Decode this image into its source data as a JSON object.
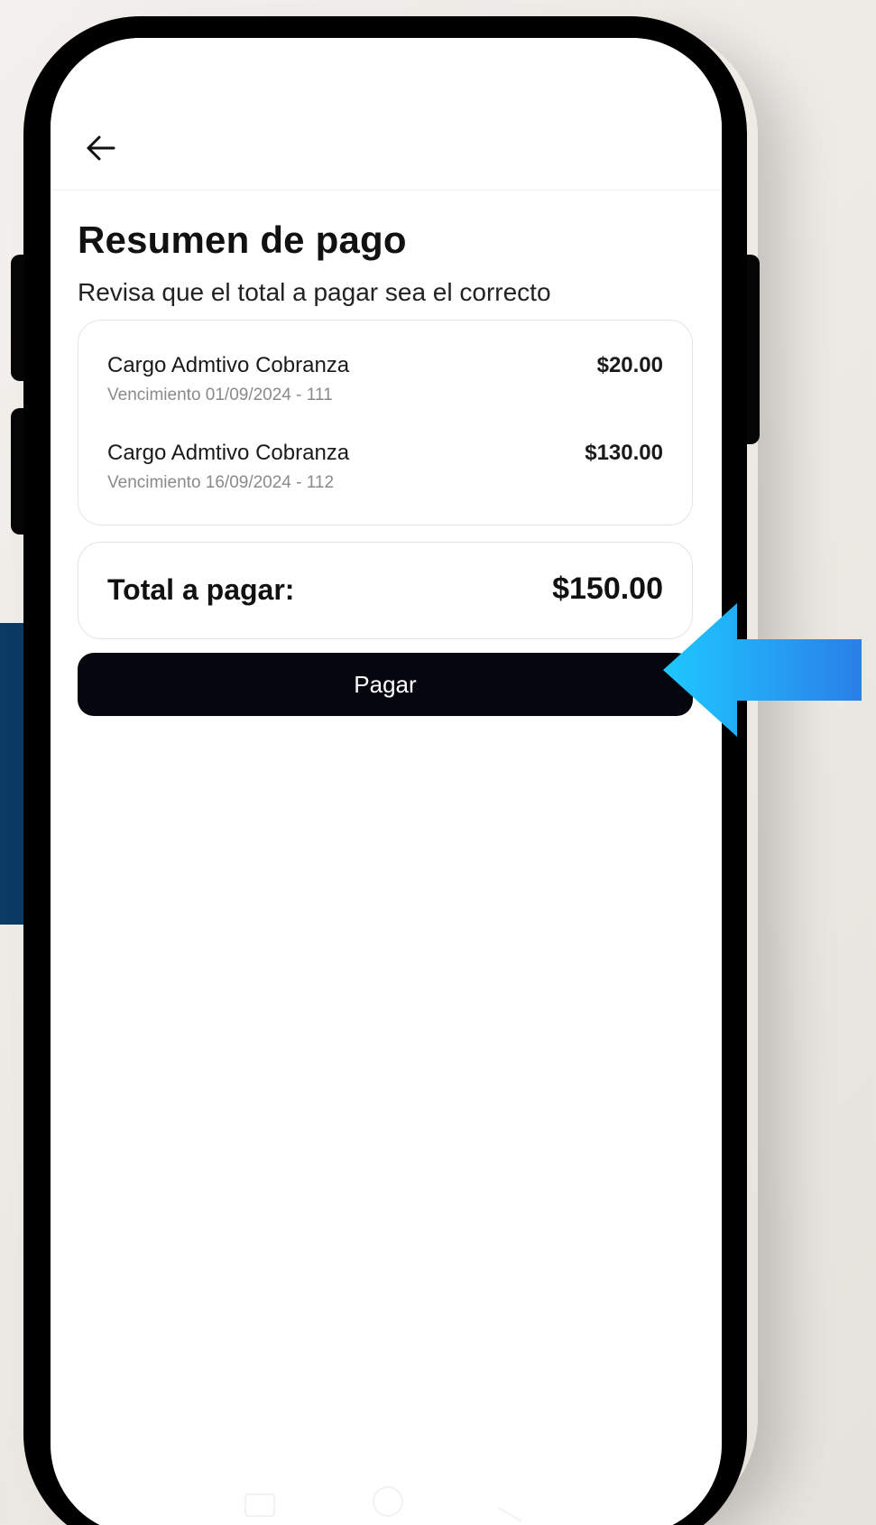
{
  "header": {
    "back_icon": "arrow-left-icon"
  },
  "page": {
    "title": "Resumen de pago",
    "subtitle": "Revisa que el total a pagar sea el correcto"
  },
  "items": [
    {
      "name": "Cargo Admtivo Cobranza",
      "detail": "Vencimiento 01/09/2024 - 111",
      "amount": "$20.00"
    },
    {
      "name": "Cargo Admtivo Cobranza",
      "detail": "Vencimiento 16/09/2024 - 112",
      "amount": "$130.00"
    }
  ],
  "total": {
    "label": "Total a pagar:",
    "amount": "$150.00"
  },
  "actions": {
    "pay_label": "Pagar"
  },
  "colors": {
    "button_bg": "#06060f",
    "arrow_start": "#1ec8ff",
    "arrow_end": "#2a7fe8",
    "side_panel": "#0b3a63"
  }
}
